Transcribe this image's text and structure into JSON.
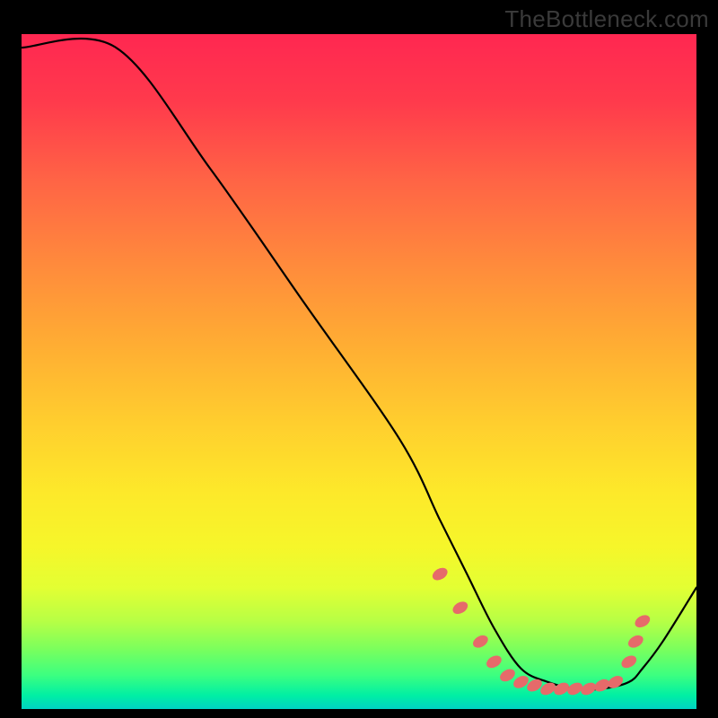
{
  "watermark": "TheBottleneck.com",
  "chart_data": {
    "type": "line",
    "title": "",
    "xlabel": "",
    "ylabel": "",
    "xlim": [
      0,
      100
    ],
    "ylim": [
      0,
      100
    ],
    "grid": false,
    "legend": false,
    "series": [
      {
        "name": "curve",
        "x": [
          0,
          14,
          28,
          42,
          56,
          62,
          66,
          70,
          74,
          78,
          82,
          86,
          90,
          92,
          95,
          100
        ],
        "values": [
          98,
          98,
          80,
          60,
          40,
          28,
          20,
          12,
          6,
          4,
          3,
          3,
          4,
          6,
          10,
          18
        ]
      }
    ],
    "markers": [
      {
        "x": 62,
        "y": 20
      },
      {
        "x": 65,
        "y": 15
      },
      {
        "x": 68,
        "y": 10
      },
      {
        "x": 70,
        "y": 7
      },
      {
        "x": 72,
        "y": 5
      },
      {
        "x": 74,
        "y": 4
      },
      {
        "x": 76,
        "y": 3.5
      },
      {
        "x": 78,
        "y": 3
      },
      {
        "x": 80,
        "y": 3
      },
      {
        "x": 82,
        "y": 3
      },
      {
        "x": 84,
        "y": 3
      },
      {
        "x": 86,
        "y": 3.5
      },
      {
        "x": 88,
        "y": 4
      },
      {
        "x": 90,
        "y": 7
      },
      {
        "x": 91,
        "y": 10
      },
      {
        "x": 92,
        "y": 13
      }
    ]
  }
}
